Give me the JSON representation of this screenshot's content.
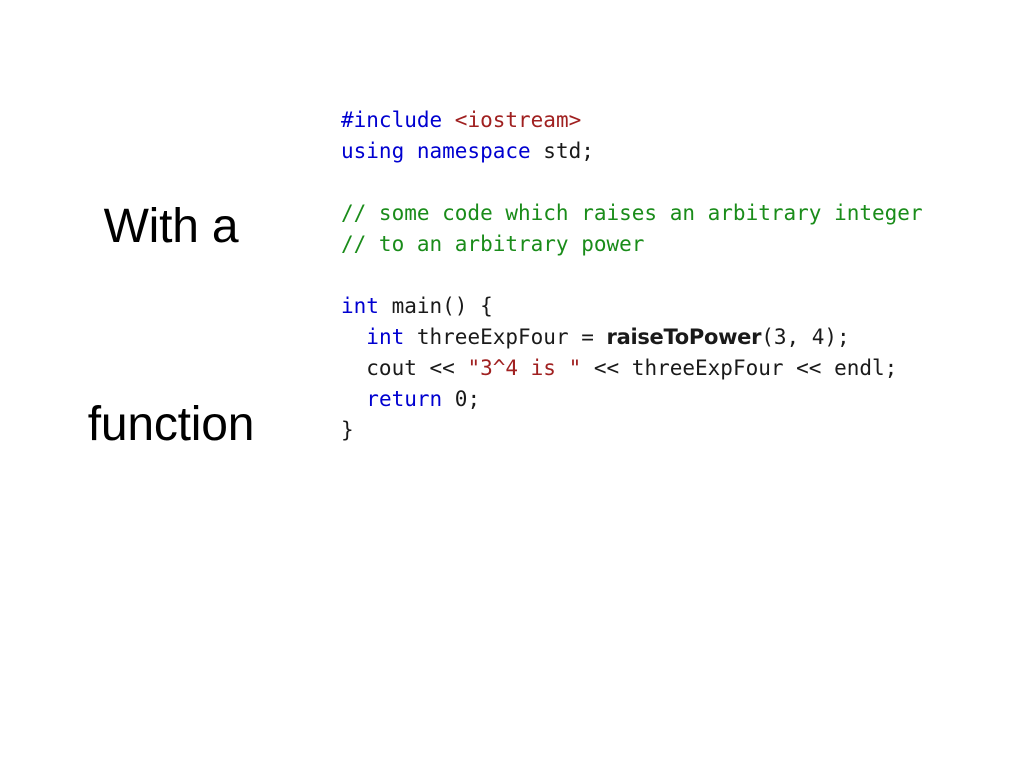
{
  "slide": {
    "background_color": "#ffffff",
    "title": {
      "lines": [
        "With a",
        "function"
      ],
      "color": "#000000"
    }
  },
  "palette": {
    "keyword": "#0000d0",
    "header": "#a02020",
    "string": "#a02020",
    "comment": "#1a8c1a",
    "plain": "#1a1a1a",
    "background": "#ffffff"
  },
  "code": {
    "language": "cpp",
    "plain_text": "#include <iostream>\nusing namespace std;\n\n// some code which raises an arbitrary integer\n// to an arbitrary power\n\nint main() {\n  int threeExpFour = raiseToPower(3, 4);\n  cout << \"3^4 is \" << threeExpFour << endl;\n  return 0;\n}",
    "lines": [
      {
        "index": 1,
        "tokens": [
          {
            "text": "#include ",
            "kind": "keyword"
          },
          {
            "text": "<iostream>",
            "kind": "header"
          }
        ]
      },
      {
        "index": 2,
        "tokens": [
          {
            "text": "using namespace ",
            "kind": "keyword"
          },
          {
            "text": "std;",
            "kind": "plain"
          }
        ]
      },
      {
        "index": 3,
        "tokens": [
          {
            "text": " ",
            "kind": "plain"
          }
        ]
      },
      {
        "index": 4,
        "tokens": [
          {
            "text": "// some code which raises an arbitrary integer",
            "kind": "comment"
          }
        ]
      },
      {
        "index": 5,
        "tokens": [
          {
            "text": "// to an arbitrary power",
            "kind": "comment"
          }
        ]
      },
      {
        "index": 6,
        "tokens": [
          {
            "text": " ",
            "kind": "plain"
          }
        ]
      },
      {
        "index": 7,
        "tokens": [
          {
            "text": "int",
            "kind": "keyword"
          },
          {
            "text": " main() {",
            "kind": "plain"
          }
        ]
      },
      {
        "index": 8,
        "tokens": [
          {
            "text": "  ",
            "kind": "plain"
          },
          {
            "text": "int",
            "kind": "keyword"
          },
          {
            "text": " threeExpFour = ",
            "kind": "plain"
          },
          {
            "text": "raiseToPower",
            "kind": "function"
          },
          {
            "text": "(3, 4);",
            "kind": "plain"
          }
        ]
      },
      {
        "index": 9,
        "tokens": [
          {
            "text": "  cout << ",
            "kind": "plain"
          },
          {
            "text": "\"3^4 is \"",
            "kind": "string"
          },
          {
            "text": " << threeExpFour << endl;",
            "kind": "plain"
          }
        ]
      },
      {
        "index": 10,
        "tokens": [
          {
            "text": "  ",
            "kind": "plain"
          },
          {
            "text": "return",
            "kind": "keyword"
          },
          {
            "text": " 0;",
            "kind": "plain"
          }
        ]
      },
      {
        "index": 11,
        "tokens": [
          {
            "text": "}",
            "kind": "plain"
          }
        ]
      }
    ]
  }
}
